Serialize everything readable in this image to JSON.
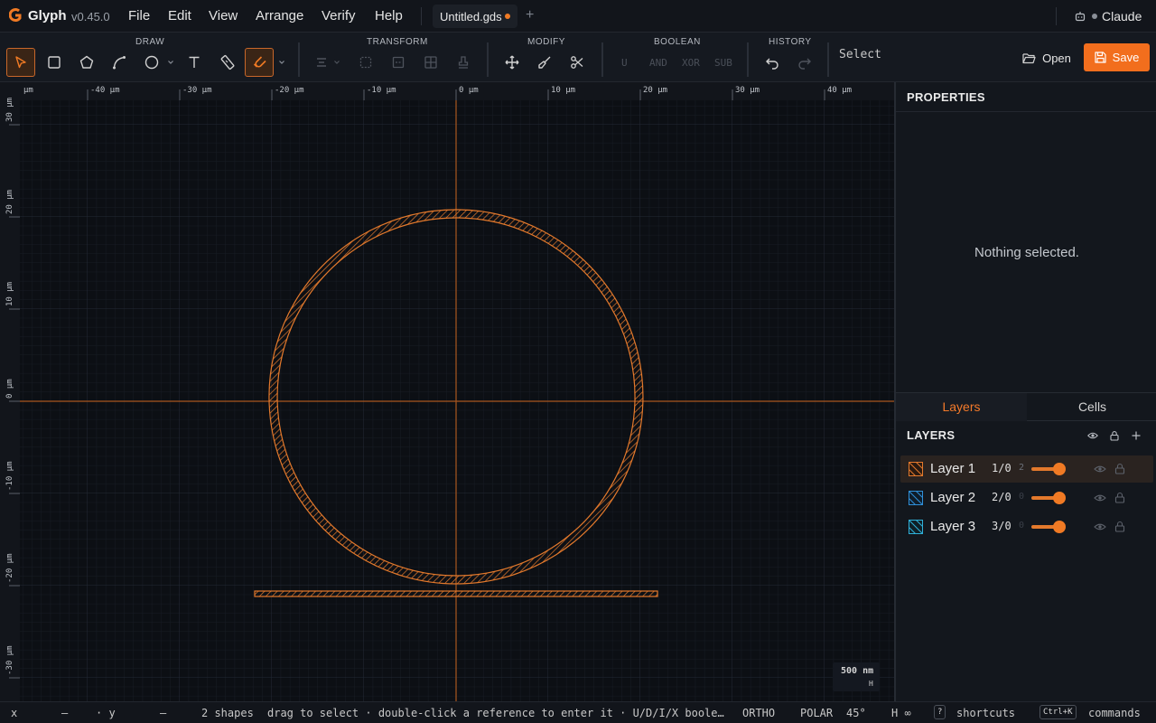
{
  "app": {
    "name": "Glyph",
    "version": "v0.45.0"
  },
  "menu": [
    "File",
    "Edit",
    "View",
    "Arrange",
    "Verify",
    "Help"
  ],
  "file_tab": {
    "label": "Untitled.gds",
    "modified": true
  },
  "user": {
    "name": "Claude"
  },
  "toolbar": {
    "groups": {
      "draw": "DRAW",
      "transform": "TRANSFORM",
      "modify": "MODIFY",
      "boolean": "BOOLEAN",
      "history": "HISTORY"
    },
    "draw_tools": [
      "select-tool",
      "rectangle-tool",
      "polygon-tool",
      "path-tool",
      "circle-tool",
      "text-tool",
      "ruler-tool",
      "snap-tool"
    ],
    "boolean_ops": [
      "U",
      "AND",
      "XOR",
      "SUB"
    ],
    "mode": "Select",
    "open_label": "Open",
    "save_label": "Save"
  },
  "canvas": {
    "x_ruler_unit": "µm",
    "x_ticks": [
      "-40 µm",
      "-30 µm",
      "-20 µm",
      "-10 µm",
      "0 µm",
      "10 µm",
      "20 µm",
      "30 µm",
      "40 µm"
    ],
    "y_ruler_unit": "µm",
    "y_ticks": [
      "30 µm",
      "20 µm",
      "10 µm",
      "0 µm",
      "-10 µm",
      "-20 µm",
      "-30 µm"
    ],
    "scale_label": "500 nm",
    "scale_sub": "H",
    "accent": "#e3792c"
  },
  "properties": {
    "title": "PROPERTIES",
    "empty_text": "Nothing selected."
  },
  "panel_tabs": {
    "layers": "Layers",
    "cells": "Cells"
  },
  "layers": {
    "title": "LAYERS",
    "items": [
      {
        "name": "Layer 1",
        "number": "1/0",
        "count": "2",
        "color": "#e3792c",
        "selected": true
      },
      {
        "name": "Layer 2",
        "number": "2/0",
        "count": "0",
        "color": "#2f8fd8",
        "selected": false
      },
      {
        "name": "Layer 3",
        "number": "3/0",
        "count": "0",
        "color": "#2fb0d8",
        "selected": false
      }
    ]
  },
  "status": {
    "x_label": "x",
    "x_value": "—",
    "y_label": "· y",
    "y_value": "—",
    "shape_count": "2 shapes",
    "hint": "drag to select · double-click a reference to enter it · U/D/I/X boole…",
    "ortho": "ORTHO",
    "polar": "POLAR",
    "polar_angle": "45°",
    "h_label": "H ∞",
    "shortcut_key": "?",
    "shortcut_label": "shortcuts",
    "commands_key": "Ctrl+K",
    "commands_label": "commands"
  }
}
